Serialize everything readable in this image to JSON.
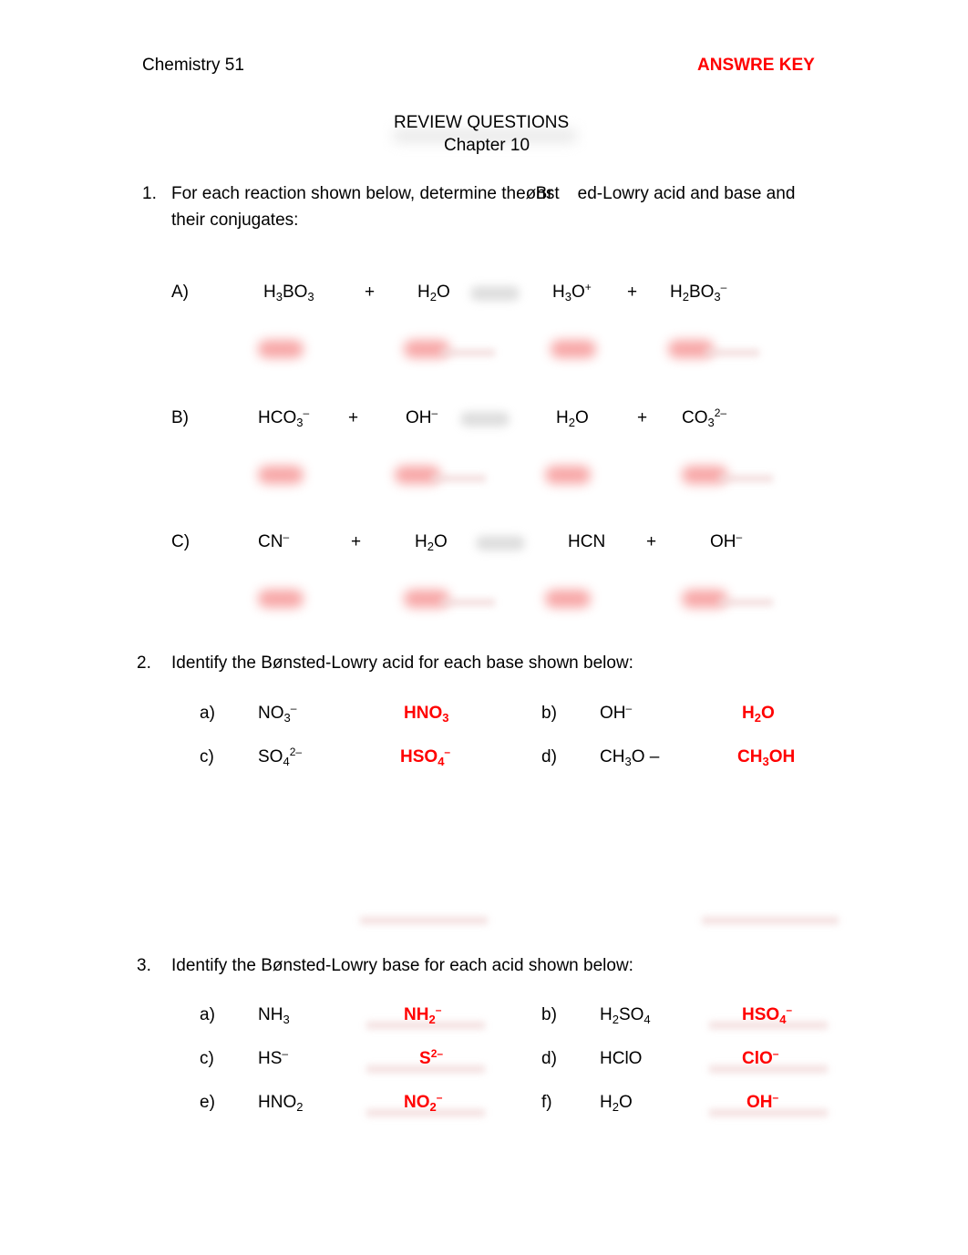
{
  "header": {
    "course": "Chemistry 51",
    "key_label": "ANSWRE KEY",
    "title": "REVIEW QUESTIONS",
    "subtitle": "Chapter 10"
  },
  "accent_color": "#ff0000",
  "q1": {
    "number": "1.",
    "text_part1": "For each reaction shown below, determine the",
    "overlap_a": "Br",
    "overlap_b": "ønst",
    "text_part2": "ed-Lowry acid and base and",
    "text_line2": "their conjugates:",
    "reactions": [
      {
        "label": "A)",
        "r1": [
          "H",
          "3",
          "BO",
          "3",
          ""
        ],
        "r2": [
          "H",
          "2",
          "O",
          "",
          ""
        ],
        "p1": [
          "H",
          "3",
          "O",
          "",
          "+"
        ],
        "p2": [
          "H",
          "2",
          "BO",
          "3",
          "–"
        ]
      },
      {
        "label": "B)",
        "r1": [
          "HCO",
          "3",
          "",
          "",
          "–"
        ],
        "r2": [
          "OH",
          "",
          "",
          "",
          "–"
        ],
        "p1": [
          "H",
          "2",
          "O",
          "",
          ""
        ],
        "p2": [
          "CO",
          "3",
          "",
          "",
          "2–"
        ]
      },
      {
        "label": "C)",
        "r1": [
          "CN",
          "",
          "",
          "",
          "–"
        ],
        "r2": [
          "H",
          "2",
          "O",
          "",
          ""
        ],
        "p1": [
          "HCN",
          "",
          "",
          "",
          ""
        ],
        "p2": [
          "OH",
          "",
          "",
          "",
          "–"
        ]
      }
    ],
    "plus": "+"
  },
  "q2": {
    "number": "2.",
    "text": "Identify the Bønsted-Lowry acid for each base shown below:",
    "items": [
      {
        "label": "a)",
        "base": "NO",
        "base_sub": "3",
        "base_sup": "–",
        "answer": "HNO",
        "answer_sub": "3",
        "answer_tail": "",
        "answer_sup": ""
      },
      {
        "label": "b)",
        "base": "OH",
        "base_sub": "",
        "base_sup": "–",
        "answer": "H",
        "answer_sub": "2",
        "answer_tail": "O",
        "answer_sup": ""
      },
      {
        "label": "c)",
        "base": "SO",
        "base_sub": "4",
        "base_sup": "2–",
        "answer": "HSO",
        "answer_sub": "4",
        "answer_tail": "",
        "answer_sup": "–"
      },
      {
        "label": "d)",
        "base": "CH",
        "base_sub": "3",
        "base_sup": "",
        "base_tail": "O –",
        "answer": "CH",
        "answer_sub": "3",
        "answer_tail": "OH",
        "answer_sup": ""
      }
    ]
  },
  "q3": {
    "number": "3.",
    "text": "Identify the Bønsted-Lowry base for each acid shown below:",
    "items": [
      {
        "label": "a)",
        "acid": "NH",
        "acid_sub": "3",
        "acid_tail": "",
        "acid_sup": "",
        "answer": "NH",
        "answer_sub": "2",
        "answer_sup": "–"
      },
      {
        "label": "b)",
        "acid": "H",
        "acid_sub": "2",
        "acid_tail": "SO",
        "acid_sub2": "4",
        "acid_sup": "",
        "answer": "HSO",
        "answer_sub": "4",
        "answer_sup": "–"
      },
      {
        "label": "c)",
        "acid": "HS",
        "acid_sub": "",
        "acid_tail": "",
        "acid_sup": "–",
        "answer": "S",
        "answer_sub": "",
        "answer_sup": "2–"
      },
      {
        "label": "d)",
        "acid": "HClO",
        "acid_sub": "",
        "acid_tail": "",
        "acid_sup": "",
        "answer": "ClO",
        "answer_sub": "",
        "answer_sup": "–"
      },
      {
        "label": "e)",
        "acid": "HNO",
        "acid_sub": "2",
        "acid_tail": "",
        "acid_sup": "",
        "answer": "NO",
        "answer_sub": "2",
        "answer_sup": "–"
      },
      {
        "label": "f)",
        "acid": "H",
        "acid_sub": "2",
        "acid_tail": "O",
        "acid_sup": "",
        "answer": "OH",
        "answer_sub": "",
        "answer_sup": "–"
      }
    ]
  }
}
